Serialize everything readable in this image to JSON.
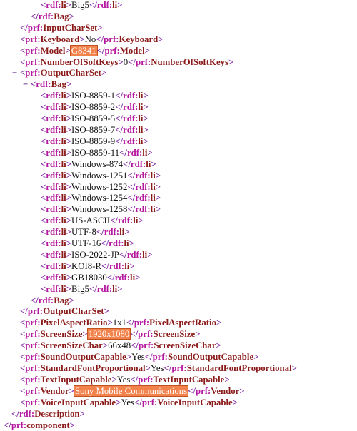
{
  "document": {
    "type": "xml-tree-view",
    "title": "UAProf RDF Description",
    "colors": {
      "background": "#ffffff",
      "bracket": "#7b1fa2",
      "namespace": "#b5179e",
      "element": "#8b1a1a",
      "text": "#111111",
      "highlight_background": "#f3834d",
      "highlight_border": "#c2521f",
      "highlight_text": "#ffffff"
    },
    "toggle_glyph": "−"
  },
  "lines": [
    {
      "indent": 4,
      "toggle": "",
      "open_ns": "rdf:",
      "open_el": "li",
      "text": "Big5",
      "close_ns": "rdf:",
      "close_el": "li",
      "highlight": false
    },
    {
      "indent": 3,
      "toggle": "",
      "close_only_ns": "rdf:",
      "close_only_el": "Bag"
    },
    {
      "indent": 2,
      "toggle": "",
      "close_only_ns": "prf:",
      "close_only_el": "InputCharSet"
    },
    {
      "indent": 2,
      "toggle": "",
      "open_ns": "prf:",
      "open_el": "Keyboard",
      "text": "No",
      "close_ns": "prf:",
      "close_el": "Keyboard",
      "highlight": false
    },
    {
      "indent": 2,
      "toggle": "",
      "open_ns": "prf:",
      "open_el": "Model",
      "text": "G8341",
      "close_ns": "prf:",
      "close_el": "Model",
      "highlight": true
    },
    {
      "indent": 2,
      "toggle": "",
      "open_ns": "prf:",
      "open_el": "NumberOfSoftKeys",
      "text": "0",
      "close_ns": "prf:",
      "close_el": "NumberOfSoftKeys",
      "highlight": false
    },
    {
      "indent": 2,
      "toggle": "−",
      "open_only_ns": "prf:",
      "open_only_el": "OutputCharSet"
    },
    {
      "indent": 3,
      "toggle": "−",
      "open_only_ns": "rdf:",
      "open_only_el": "Bag"
    },
    {
      "indent": 4,
      "toggle": "",
      "open_ns": "rdf:",
      "open_el": "li",
      "text": "ISO-8859-1",
      "close_ns": "rdf:",
      "close_el": "li",
      "highlight": false
    },
    {
      "indent": 4,
      "toggle": "",
      "open_ns": "rdf:",
      "open_el": "li",
      "text": "ISO-8859-2",
      "close_ns": "rdf:",
      "close_el": "li",
      "highlight": false
    },
    {
      "indent": 4,
      "toggle": "",
      "open_ns": "rdf:",
      "open_el": "li",
      "text": "ISO-8859-5",
      "close_ns": "rdf:",
      "close_el": "li",
      "highlight": false
    },
    {
      "indent": 4,
      "toggle": "",
      "open_ns": "rdf:",
      "open_el": "li",
      "text": "ISO-8859-7",
      "close_ns": "rdf:",
      "close_el": "li",
      "highlight": false
    },
    {
      "indent": 4,
      "toggle": "",
      "open_ns": "rdf:",
      "open_el": "li",
      "text": "ISO-8859-9",
      "close_ns": "rdf:",
      "close_el": "li",
      "highlight": false
    },
    {
      "indent": 4,
      "toggle": "",
      "open_ns": "rdf:",
      "open_el": "li",
      "text": "ISO-8859-11",
      "close_ns": "rdf:",
      "close_el": "li",
      "highlight": false
    },
    {
      "indent": 4,
      "toggle": "",
      "open_ns": "rdf:",
      "open_el": "li",
      "text": "Windows-874",
      "close_ns": "rdf:",
      "close_el": "li",
      "highlight": false
    },
    {
      "indent": 4,
      "toggle": "",
      "open_ns": "rdf:",
      "open_el": "li",
      "text": "Windows-1251",
      "close_ns": "rdf:",
      "close_el": "li",
      "highlight": false
    },
    {
      "indent": 4,
      "toggle": "",
      "open_ns": "rdf:",
      "open_el": "li",
      "text": "Windows-1252",
      "close_ns": "rdf:",
      "close_el": "li",
      "highlight": false
    },
    {
      "indent": 4,
      "toggle": "",
      "open_ns": "rdf:",
      "open_el": "li",
      "text": "Windows-1254",
      "close_ns": "rdf:",
      "close_el": "li",
      "highlight": false
    },
    {
      "indent": 4,
      "toggle": "",
      "open_ns": "rdf:",
      "open_el": "li",
      "text": "Windows-1258",
      "close_ns": "rdf:",
      "close_el": "li",
      "highlight": false
    },
    {
      "indent": 4,
      "toggle": "",
      "open_ns": "rdf:",
      "open_el": "li",
      "text": "US-ASCII",
      "close_ns": "rdf:",
      "close_el": "li",
      "highlight": false
    },
    {
      "indent": 4,
      "toggle": "",
      "open_ns": "rdf:",
      "open_el": "li",
      "text": "UTF-8",
      "close_ns": "rdf:",
      "close_el": "li",
      "highlight": false
    },
    {
      "indent": 4,
      "toggle": "",
      "open_ns": "rdf:",
      "open_el": "li",
      "text": "UTF-16",
      "close_ns": "rdf:",
      "close_el": "li",
      "highlight": false
    },
    {
      "indent": 4,
      "toggle": "",
      "open_ns": "rdf:",
      "open_el": "li",
      "text": "ISO-2022-JP",
      "close_ns": "rdf:",
      "close_el": "li",
      "highlight": false
    },
    {
      "indent": 4,
      "toggle": "",
      "open_ns": "rdf:",
      "open_el": "li",
      "text": "KOI8-R",
      "close_ns": "rdf:",
      "close_el": "li",
      "highlight": false
    },
    {
      "indent": 4,
      "toggle": "",
      "open_ns": "rdf:",
      "open_el": "li",
      "text": "GB18030",
      "close_ns": "rdf:",
      "close_el": "li",
      "highlight": false
    },
    {
      "indent": 4,
      "toggle": "",
      "open_ns": "rdf:",
      "open_el": "li",
      "text": "Big5",
      "close_ns": "rdf:",
      "close_el": "li",
      "highlight": false
    },
    {
      "indent": 3,
      "toggle": "",
      "close_only_ns": "rdf:",
      "close_only_el": "Bag"
    },
    {
      "indent": 2,
      "toggle": "",
      "close_only_ns": "prf:",
      "close_only_el": "OutputCharSet"
    },
    {
      "indent": 2,
      "toggle": "",
      "open_ns": "prf:",
      "open_el": "PixelAspectRatio",
      "text": "1x1",
      "close_ns": "prf:",
      "close_el": "PixelAspectRatio",
      "highlight": false
    },
    {
      "indent": 2,
      "toggle": "",
      "open_ns": "prf:",
      "open_el": "ScreenSize",
      "text": "1920x1080",
      "close_ns": "prf:",
      "close_el": "ScreenSize",
      "highlight": true
    },
    {
      "indent": 2,
      "toggle": "",
      "open_ns": "prf:",
      "open_el": "ScreenSizeChar",
      "text": "66x48",
      "close_ns": "prf:",
      "close_el": "ScreenSizeChar",
      "highlight": false
    },
    {
      "indent": 2,
      "toggle": "",
      "open_ns": "prf:",
      "open_el": "SoundOutputCapable",
      "text": "Yes",
      "close_ns": "prf:",
      "close_el": "SoundOutputCapable",
      "highlight": false
    },
    {
      "indent": 2,
      "toggle": "",
      "open_ns": "prf:",
      "open_el": "StandardFontProportional",
      "text": "Yes",
      "close_ns": "prf:",
      "close_el": "StandardFontProportional",
      "highlight": false
    },
    {
      "indent": 2,
      "toggle": "",
      "open_ns": "prf:",
      "open_el": "TextInputCapable",
      "text": "Yes",
      "close_ns": "prf:",
      "close_el": "TextInputCapable",
      "highlight": false
    },
    {
      "indent": 2,
      "toggle": "",
      "open_ns": "prf:",
      "open_el": "Vendor",
      "text": "Sony Mobile Communications",
      "close_ns": "prf:",
      "close_el": "Vendor",
      "highlight": true
    },
    {
      "indent": 2,
      "toggle": "",
      "open_ns": "prf:",
      "open_el": "VoiceInputCapable",
      "text": "Yes",
      "close_ns": "prf:",
      "close_el": "VoiceInputCapable",
      "highlight": false
    },
    {
      "indent": 1,
      "toggle": "",
      "close_only_ns": "rdf:",
      "close_only_el": "Description"
    },
    {
      "indent": 0,
      "toggle": "",
      "close_only_ns": "prf:",
      "close_only_el": "component"
    }
  ]
}
